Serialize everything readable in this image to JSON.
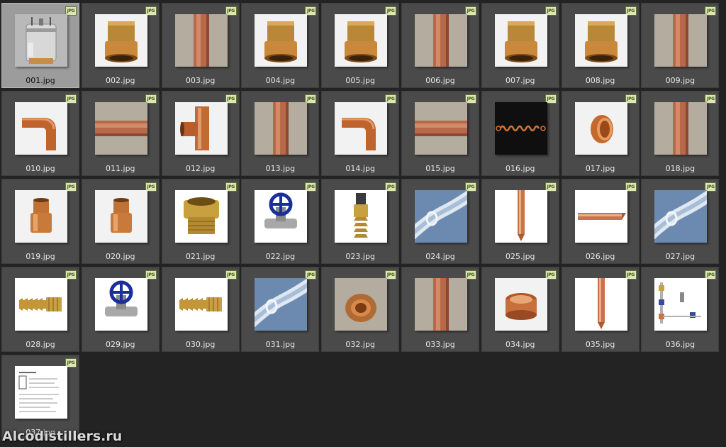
{
  "badge_label": "JPG",
  "watermark": "Alcodistillers.ru",
  "selected_index": 0,
  "files": [
    {
      "name": "001.jpg",
      "kind": "pot"
    },
    {
      "name": "002.jpg",
      "kind": "reducer"
    },
    {
      "name": "003.jpg",
      "kind": "pipe-v"
    },
    {
      "name": "004.jpg",
      "kind": "reducer"
    },
    {
      "name": "005.jpg",
      "kind": "reducer"
    },
    {
      "name": "006.jpg",
      "kind": "pipe-v"
    },
    {
      "name": "007.jpg",
      "kind": "reducer"
    },
    {
      "name": "008.jpg",
      "kind": "reducer"
    },
    {
      "name": "009.jpg",
      "kind": "pipe-v"
    },
    {
      "name": "010.jpg",
      "kind": "elbow"
    },
    {
      "name": "011.jpg",
      "kind": "pipe-h"
    },
    {
      "name": "012.jpg",
      "kind": "tee"
    },
    {
      "name": "013.jpg",
      "kind": "pipe-v"
    },
    {
      "name": "014.jpg",
      "kind": "elbow"
    },
    {
      "name": "015.jpg",
      "kind": "pipe-h"
    },
    {
      "name": "016.jpg",
      "kind": "spring"
    },
    {
      "name": "017.jpg",
      "kind": "cap"
    },
    {
      "name": "018.jpg",
      "kind": "pipe-v"
    },
    {
      "name": "019.jpg",
      "kind": "coupler"
    },
    {
      "name": "020.jpg",
      "kind": "coupler"
    },
    {
      "name": "021.jpg",
      "kind": "brass-nut"
    },
    {
      "name": "022.jpg",
      "kind": "valve"
    },
    {
      "name": "023.jpg",
      "kind": "barb-v"
    },
    {
      "name": "024.jpg",
      "kind": "tube"
    },
    {
      "name": "025.jpg",
      "kind": "rod-v"
    },
    {
      "name": "026.jpg",
      "kind": "rod-h"
    },
    {
      "name": "027.jpg",
      "kind": "tube"
    },
    {
      "name": "028.jpg",
      "kind": "barb-h"
    },
    {
      "name": "029.jpg",
      "kind": "valve"
    },
    {
      "name": "030.jpg",
      "kind": "barb-h"
    },
    {
      "name": "031.jpg",
      "kind": "tube"
    },
    {
      "name": "032.jpg",
      "kind": "cap2"
    },
    {
      "name": "033.jpg",
      "kind": "pipe-v"
    },
    {
      "name": "034.jpg",
      "kind": "cup"
    },
    {
      "name": "035.jpg",
      "kind": "rod-v"
    },
    {
      "name": "036.jpg",
      "kind": "diagram"
    },
    {
      "name": "037.jpg",
      "kind": "doc"
    }
  ]
}
